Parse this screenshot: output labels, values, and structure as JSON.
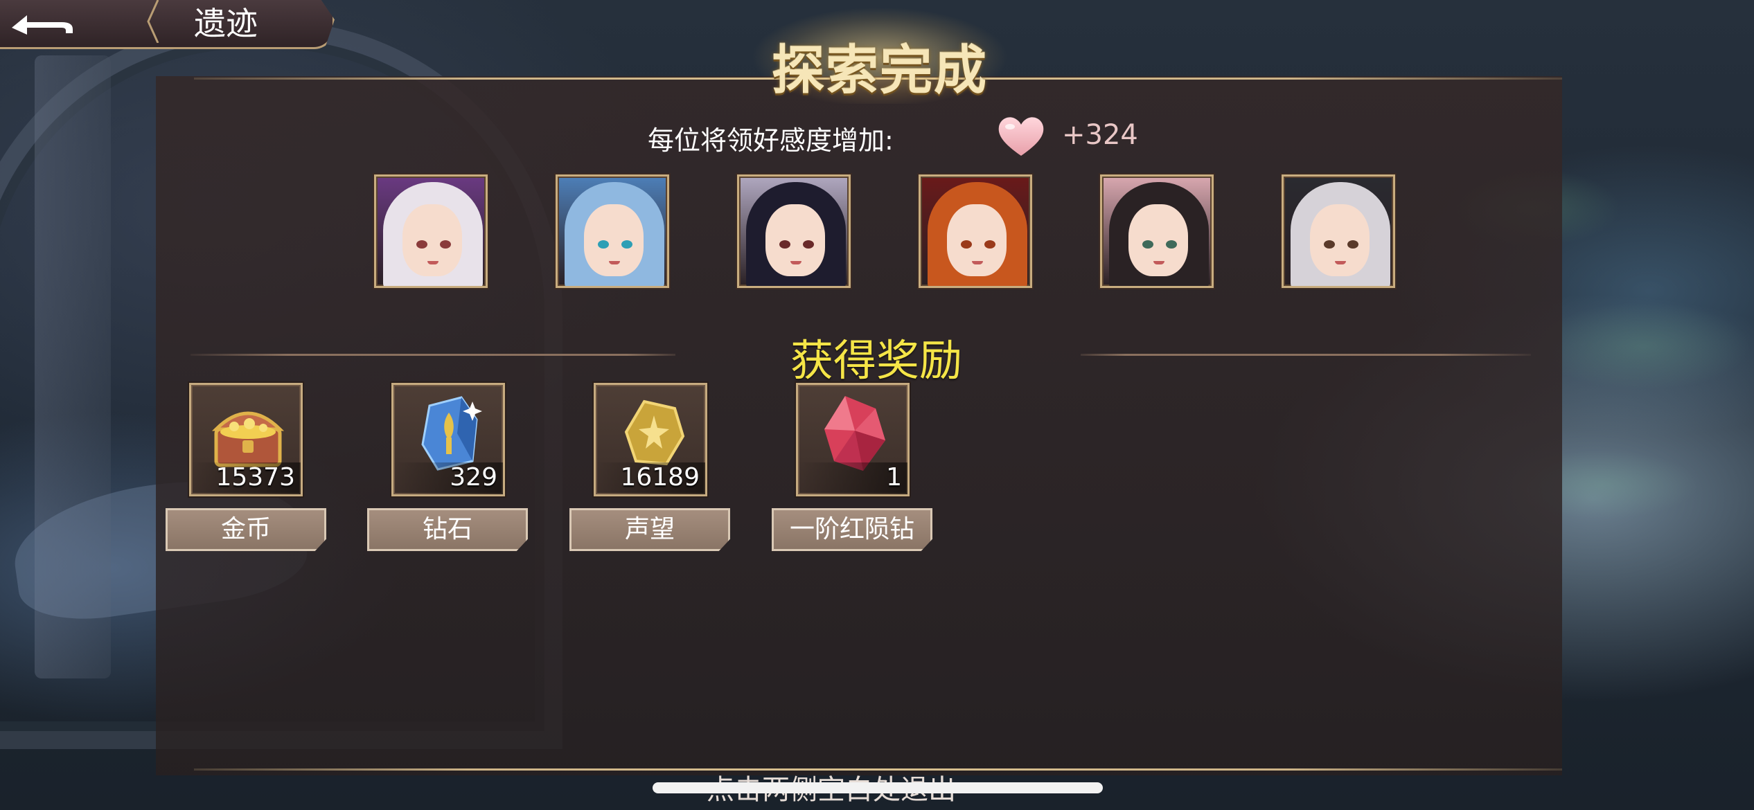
{
  "header": {
    "back_icon": "back-arrow-icon",
    "title": "遗迹"
  },
  "banner": {
    "title": "探索完成"
  },
  "affection": {
    "label": "每位将领好感度增加:",
    "icon": "heart-icon",
    "value": "+324"
  },
  "heroes": [
    {
      "name": "hero-portrait-1",
      "hair": "#e8e2ea",
      "eye": "#8a3b3b",
      "accent": "#6a3a82"
    },
    {
      "name": "hero-portrait-2",
      "hair": "#8fb8e0",
      "eye": "#2e9fb5",
      "accent": "#4d7fb8"
    },
    {
      "name": "hero-portrait-3",
      "hair": "#1e1c2e",
      "eye": "#6a2a2a",
      "accent": "#b0a8c0"
    },
    {
      "name": "hero-portrait-4",
      "hair": "#c8571e",
      "eye": "#9a3a1a",
      "accent": "#6a1a1a"
    },
    {
      "name": "hero-portrait-5",
      "hair": "#2a2224",
      "eye": "#3f6a5a",
      "accent": "#d9a8b0"
    },
    {
      "name": "hero-portrait-6",
      "hair": "#d6d2d8",
      "eye": "#5a3a2a",
      "accent": "#2a2a30"
    }
  ],
  "rewards_heading": "获得奖励",
  "rewards": [
    {
      "label": "金币",
      "count": "15373",
      "icon": "treasure-chest-icon"
    },
    {
      "label": "钻石",
      "count": "329",
      "icon": "diamond-crystal-icon"
    },
    {
      "label": "声望",
      "count": "16189",
      "icon": "prestige-badge-icon"
    },
    {
      "label": "一阶红陨钻",
      "count": "1",
      "icon": "red-gem-icon"
    }
  ],
  "footer": {
    "exit_hint": "点击两侧空白处退出"
  },
  "colors": {
    "title_gold": "#f6e6b8",
    "rewards_heading": "#f5e547",
    "frame_gold": "#c6ab80",
    "affection_value": "#e9c7c6"
  }
}
